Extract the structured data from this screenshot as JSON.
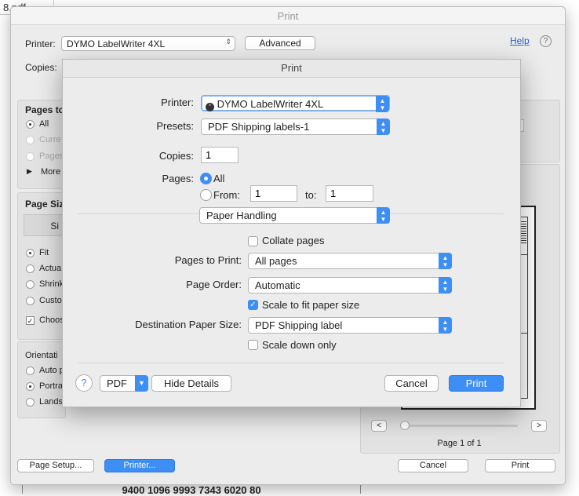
{
  "background": {
    "doc_title": "8.pdf - ",
    "doc_bottom_text": "9400 1096 9993 7343 6020 80"
  },
  "outer": {
    "title": "Print",
    "printer_label": "Printer:",
    "printer_value": "DYMO LabelWriter 4XL",
    "advanced_button": "Advanced",
    "help_link": "Help",
    "help_icon": "question-circle-icon",
    "copies_label": "Copies:",
    "pages_to_print_label": "Pages to",
    "pages_options": [
      "All",
      "Curre",
      "Pages",
      "More"
    ],
    "page_sizing_label": "Page Siz",
    "size_button": "Si",
    "sizing_options": [
      "Fit",
      "Actua",
      "Shrink",
      "Custo"
    ],
    "choose_label": "Choos",
    "orientation_label": "Orientati",
    "orientation_options": [
      "Auto p",
      "Portra",
      "Lands"
    ],
    "page_indicator": "Page 1 of 1",
    "prev_button": "<",
    "next_button": ">",
    "page_setup_button": "Page Setup...",
    "printer_button": "Printer...",
    "cancel_button": "Cancel",
    "print_button": "Print"
  },
  "sheet": {
    "title": "Print",
    "printer_label": "Printer:",
    "printer_value": "DYMO LabelWriter 4XL",
    "presets_label": "Presets:",
    "presets_value": "PDF Shipping labels-1",
    "copies_label": "Copies:",
    "copies_value": "1",
    "pages_label": "Pages:",
    "pages_all": "All",
    "pages_from": "From:",
    "from_value": "1",
    "to_label": "to:",
    "to_value": "1",
    "section_value": "Paper Handling",
    "collate_label": "Collate pages",
    "pages_to_print_label": "Pages to Print:",
    "pages_to_print_value": "All pages",
    "page_order_label": "Page Order:",
    "page_order_value": "Automatic",
    "scale_fit_label": "Scale to fit paper size",
    "dest_paper_label": "Destination Paper Size:",
    "dest_paper_value": "PDF Shipping label",
    "scale_down_label": "Scale down only",
    "help_button": "?",
    "pdf_button": "PDF",
    "hide_details_button": "Hide Details",
    "cancel_button": "Cancel",
    "print_button": "Print"
  },
  "colors": {
    "accent": "#3d8ef5",
    "link": "#2a60c9"
  }
}
